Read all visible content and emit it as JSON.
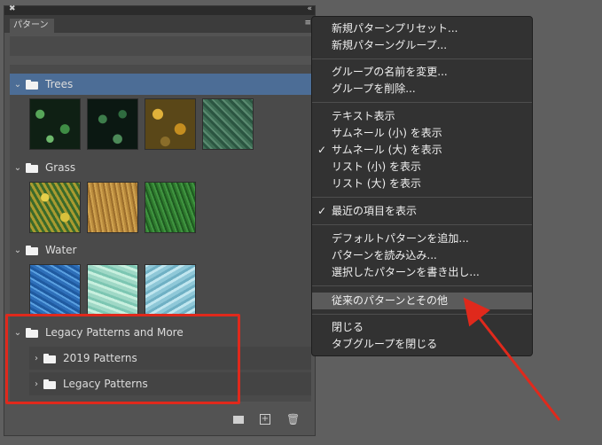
{
  "panel": {
    "tab_label": "パターン",
    "groups": [
      {
        "name": "Trees",
        "expanded": true,
        "selected": true
      },
      {
        "name": "Grass",
        "expanded": true,
        "selected": false
      },
      {
        "name": "Water",
        "expanded": true,
        "selected": false
      },
      {
        "name": "Legacy Patterns and More",
        "expanded": true,
        "selected": false,
        "subgroups": [
          {
            "name": "2019 Patterns",
            "expanded": false
          },
          {
            "name": "Legacy Patterns",
            "expanded": false
          }
        ]
      }
    ],
    "bottom_icons": [
      "new-group-folder-icon",
      "add-pattern-icon",
      "trash-icon"
    ]
  },
  "menu": {
    "items": [
      {
        "label": "新規パターンプリセット...",
        "checked": false
      },
      {
        "label": "新規パターングループ...",
        "checked": false
      },
      {
        "label": "グループの名前を変更...",
        "checked": false
      },
      {
        "label": "グループを削除...",
        "checked": false
      },
      {
        "label": "テキスト表示",
        "checked": false
      },
      {
        "label": "サムネール (小) を表示",
        "checked": false
      },
      {
        "label": "サムネール (大) を表示",
        "checked": true
      },
      {
        "label": "リスト (小) を表示",
        "checked": false
      },
      {
        "label": "リスト (大) を表示",
        "checked": false
      },
      {
        "label": "最近の項目を表示",
        "checked": true
      },
      {
        "label": "デフォルトパターンを追加...",
        "checked": false
      },
      {
        "label": "パターンを読み込み...",
        "checked": false
      },
      {
        "label": "選択したパターンを書き出し...",
        "checked": false
      },
      {
        "label": "従来のパターンとその他",
        "checked": false,
        "highlighted": true
      },
      {
        "label": "閉じる",
        "checked": false
      },
      {
        "label": "タブグループを閉じる",
        "checked": false
      }
    ]
  },
  "annotation_color": "#e0291c"
}
